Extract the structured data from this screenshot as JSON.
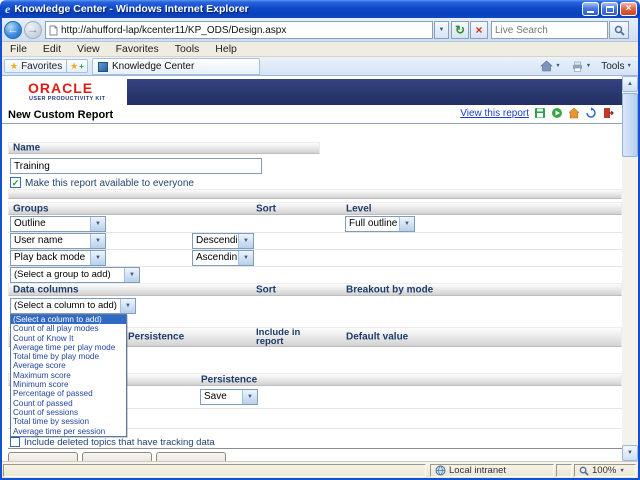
{
  "titlebar": {
    "title": "Knowledge Center - Windows Internet Explorer"
  },
  "addressbar": {
    "url": "http://ahufford-lap/kcenter11/KP_ODS/Design.aspx",
    "search_placeholder": "Live Search"
  },
  "menubar": {
    "items": [
      "File",
      "Edit",
      "View",
      "Favorites",
      "Tools",
      "Help"
    ]
  },
  "favbar": {
    "favorites_label": "Favorites",
    "tab_title": "Knowledge Center",
    "tools_label": "Tools"
  },
  "branding": {
    "logo": "ORACLE",
    "tagline": "USER PRODUCTIVITY KIT"
  },
  "page": {
    "title": "New Custom Report",
    "view_report_link": "View this report"
  },
  "name_section": {
    "header": "Name",
    "name_value": "Training",
    "share_checkbox_label": "Make this report available to everyone"
  },
  "groups_section": {
    "header": "Groups",
    "sort_header": "Sort",
    "level_header": "Level",
    "rows": [
      {
        "group": "Outline",
        "sort": "",
        "level": "Full outline"
      },
      {
        "group": "User name",
        "sort": "Descending",
        "level": ""
      },
      {
        "group": "Play back mode",
        "sort": "Ascending",
        "level": ""
      },
      {
        "group": "(Select a group to add)",
        "sort": "",
        "level": ""
      }
    ]
  },
  "data_columns_section": {
    "header": "Data columns",
    "sort_header": "Sort",
    "breakout_header": "Breakout by mode",
    "dropdown_options": [
      "(Select a column to add)",
      "Count of all play modes",
      "Count of Know It",
      "Average time per play mode",
      "Total time by play mode",
      "Average score",
      "Maximum score",
      "Minimum score",
      "Percentage of passed",
      "Count of passed",
      "Count of sessions",
      "Total time by session",
      "Average time per session"
    ],
    "columns_table": {
      "persistence_header": "Persistence",
      "include_header": "Include in report",
      "default_header": "Default value"
    }
  },
  "details_section": {
    "persistence_header": "Persistence",
    "persistence_value": "Save"
  },
  "footer": {
    "deleted_topics_checkbox_label": "Include deleted topics that have tracking data"
  },
  "statusbar": {
    "zone": "Local intranet",
    "zoom": "100%"
  },
  "icons": {
    "ie_logo": "e",
    "back_arrow": "←",
    "forward_arrow": "→",
    "chevron_down": "▼",
    "scroll_up": "▲",
    "scroll_down": "▼",
    "refresh": "↻",
    "stop": "×",
    "close": "×",
    "star": "★",
    "plus": "+",
    "check": "✓"
  },
  "colors": {
    "titlebar_blue": "#0f4ac9",
    "banner_navy": "#2a3569",
    "oracle_red": "#e21b16",
    "section_header_text": "#1e3d6b",
    "selection_blue": "#316ac5",
    "link_blue": "#1a3dc8"
  }
}
